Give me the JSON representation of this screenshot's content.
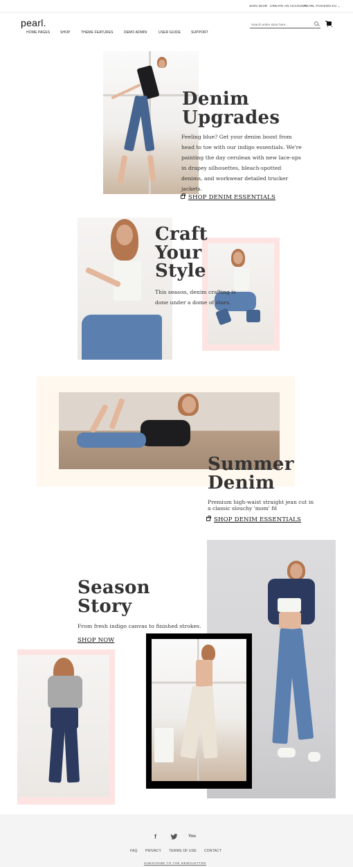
{
  "topbar": {
    "sign_in": "SIGN IN",
    "or": "OR",
    "create_account": "CREATE AN ACCOUNT",
    "store_selector": "PEARL FASHION KU"
  },
  "header": {
    "logo": "pearl.",
    "nav": [
      "HOME PAGES",
      "SHOP",
      "THEME FEATURES",
      "DEMO ADMIN",
      "USER GUIDE",
      "SUPPORT"
    ],
    "search_placeholder": "Search entire store here...",
    "icons": {
      "search": "search-icon",
      "cart": "cart-icon"
    }
  },
  "sections": {
    "denim_upgrades": {
      "title_line1": "Denim",
      "title_line2": "Upgrades",
      "body": "Feeling blue? Get your denim boost from head to toe with our indigo essentials. We're painting the day cerulean with new lace-ups in drapey silhouettes, bleach-spotted denims, and workwear detailed trucker jackets.",
      "cta": "SHOP DENIM ESSENTIALS"
    },
    "craft_your_style": {
      "title_line1": "Craft",
      "title_line2": "Your",
      "title_line3": "Style",
      "body": "This season, denim crafting is done under a dome of stars."
    },
    "summer_denim": {
      "title_line1": "Summer",
      "title_line2": "Denim",
      "body": "Premium high-waist straight jean cut in a classic slouchy 'mom' fit",
      "cta": "SHOP DENIM ESSENTIALS"
    },
    "season_story": {
      "title_line1": "Season",
      "title_line2": "Story",
      "body": "From fresh indigo canvas to finished strokes.",
      "cta": "SHOP NOW"
    }
  },
  "footer": {
    "social": {
      "facebook": "f",
      "twitter": "twitter-icon",
      "youtube": "You"
    },
    "links": [
      "FAQ",
      "PRIVACY",
      "TERMS OF USE",
      "CONTACT"
    ],
    "subscribe": "SUBSCRIBE TO THE NEWSLETTER"
  },
  "colors": {
    "frame_pink": "#fde4e2",
    "frame_cream": "#fff8ee",
    "footer_bg": "#f4f4f4",
    "heading": "#333333"
  }
}
